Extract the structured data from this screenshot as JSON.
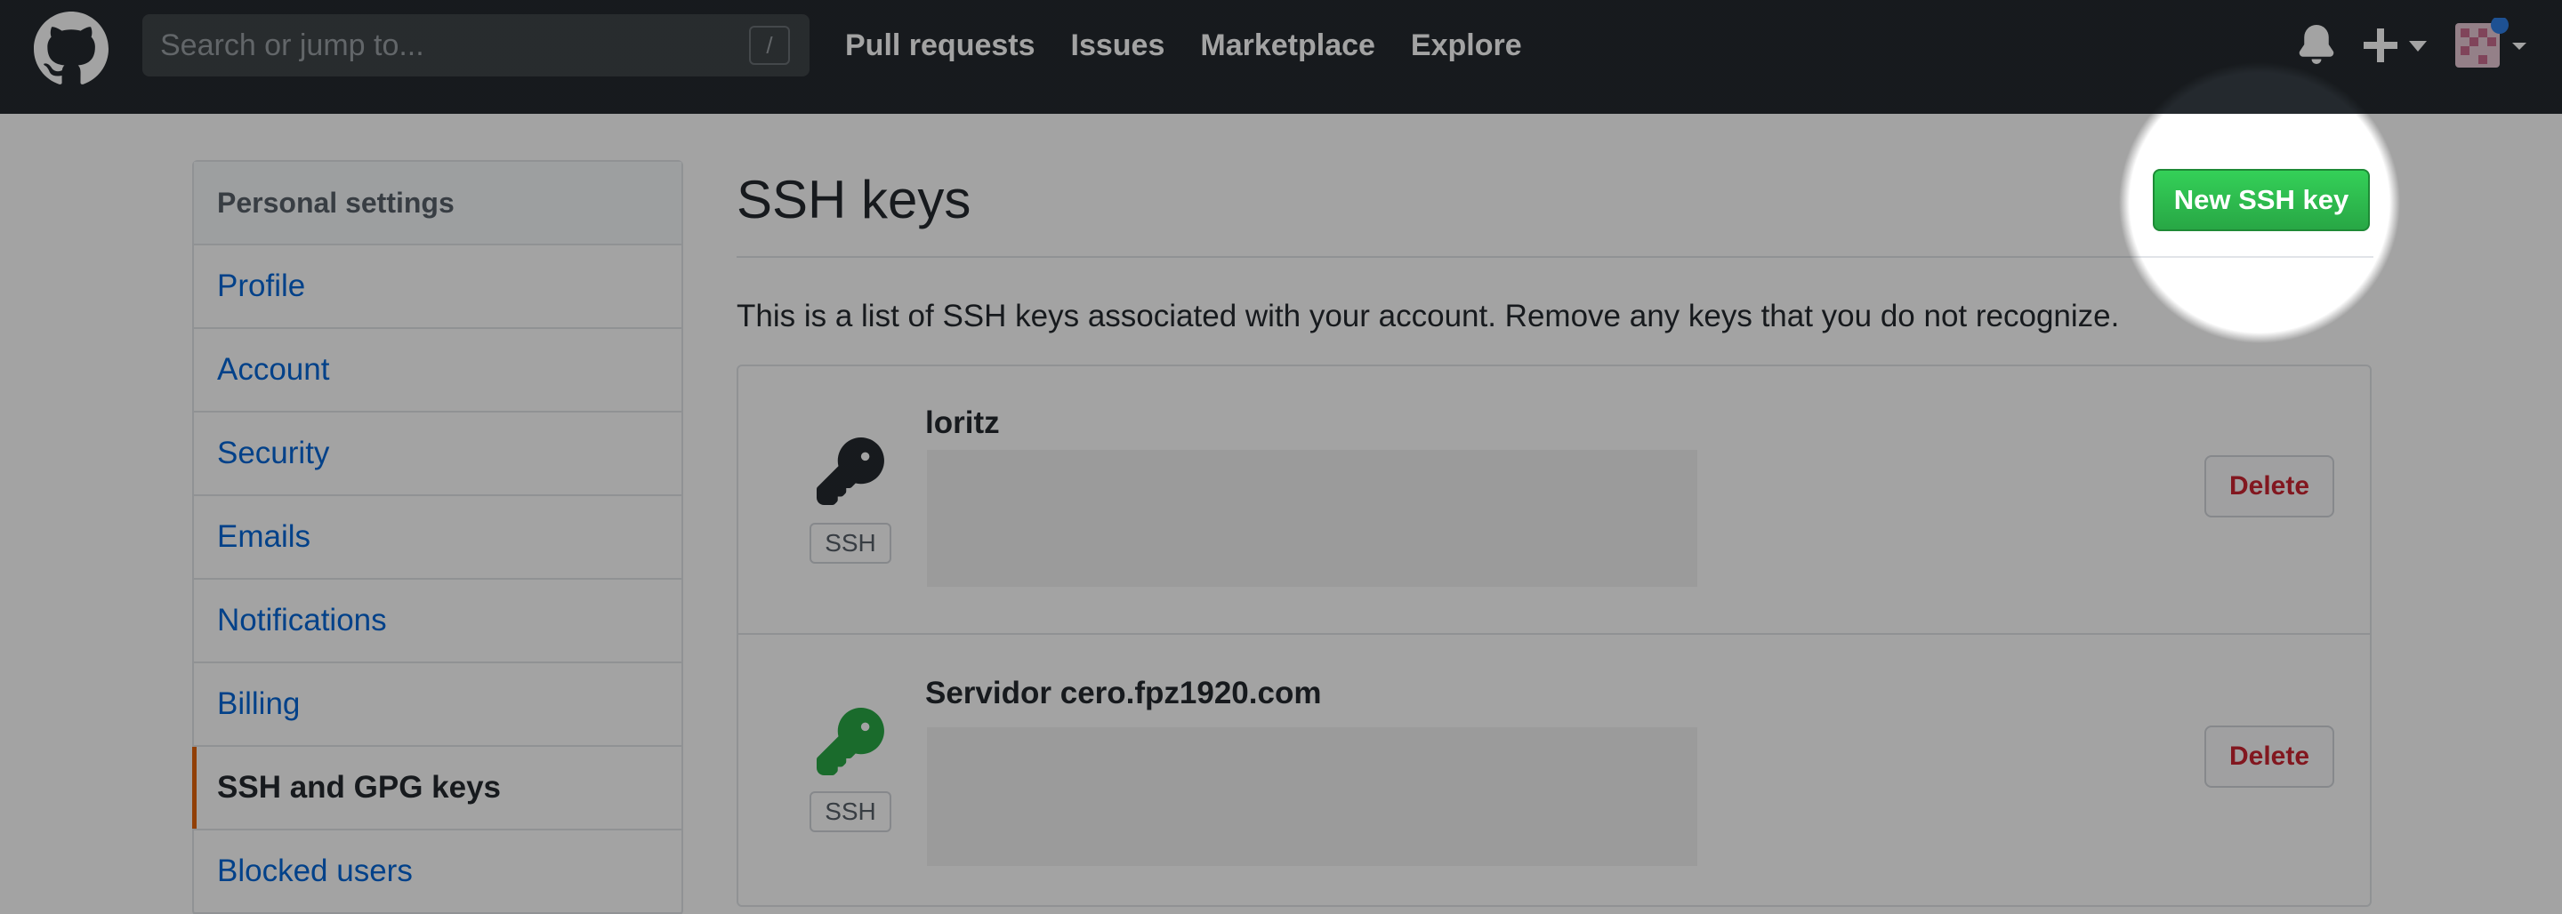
{
  "header": {
    "search_placeholder": "Search or jump to...",
    "search_shortcut": "/",
    "nav": [
      "Pull requests",
      "Issues",
      "Marketplace",
      "Explore"
    ]
  },
  "sidebar": {
    "title": "Personal settings",
    "items": [
      {
        "label": "Profile",
        "active": false
      },
      {
        "label": "Account",
        "active": false
      },
      {
        "label": "Security",
        "active": false
      },
      {
        "label": "Emails",
        "active": false
      },
      {
        "label": "Notifications",
        "active": false
      },
      {
        "label": "Billing",
        "active": false
      },
      {
        "label": "SSH and GPG keys",
        "active": true
      },
      {
        "label": "Blocked users",
        "active": false
      }
    ]
  },
  "main": {
    "title": "SSH keys",
    "new_key_button": "New SSH key",
    "description": "This is a list of SSH keys associated with your account. Remove any keys that you do not recognize.",
    "keys": [
      {
        "title": "loritz",
        "badge": "SSH",
        "icon_color": "#24292e",
        "delete_label": "Delete"
      },
      {
        "title": "Servidor cero.fpz1920.com",
        "badge": "SSH",
        "icon_color": "#28a745",
        "delete_label": "Delete"
      }
    ]
  },
  "colors": {
    "header_bg": "#24292e",
    "link": "#0366d6",
    "primary_button": "#28a745",
    "danger": "#cb2431",
    "active_marker": "#e36209"
  }
}
